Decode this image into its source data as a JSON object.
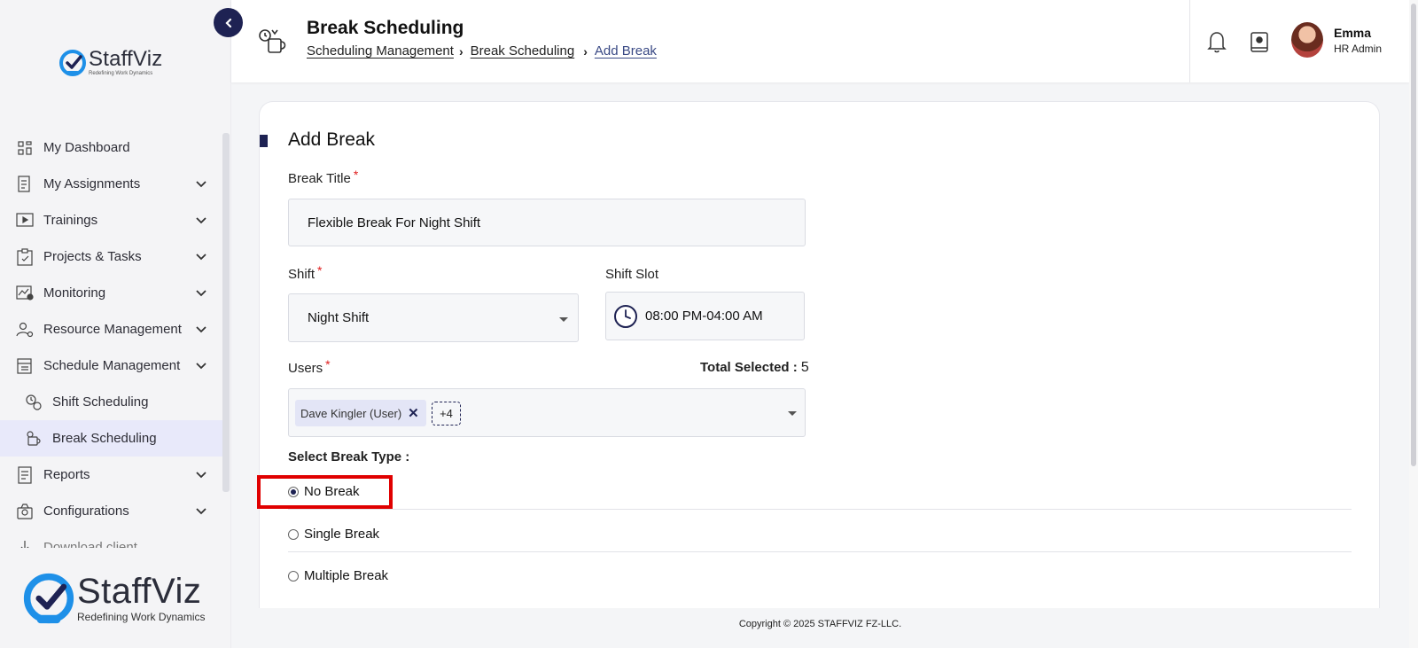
{
  "brand": {
    "name": "StaffViz",
    "tagline": "Redefining Work Dynamics"
  },
  "sidebar": {
    "items": [
      {
        "label": "My Dashboard",
        "icon": "dashboard-icon",
        "expandable": false
      },
      {
        "label": "My Assignments",
        "icon": "assignments-icon",
        "expandable": true
      },
      {
        "label": "Trainings",
        "icon": "trainings-icon",
        "expandable": true
      },
      {
        "label": "Projects & Tasks",
        "icon": "clipboard-icon",
        "expandable": true
      },
      {
        "label": "Monitoring",
        "icon": "monitoring-icon",
        "expandable": true
      },
      {
        "label": "Resource Management",
        "icon": "resource-icon",
        "expandable": true
      },
      {
        "label": "Schedule Management",
        "icon": "schedule-icon",
        "expandable": true
      },
      {
        "label": "Shift Scheduling",
        "icon": "shift-icon",
        "expandable": false,
        "sub": true
      },
      {
        "label": "Break Scheduling",
        "icon": "break-icon",
        "expandable": false,
        "sub": true,
        "active": true
      },
      {
        "label": "Reports",
        "icon": "reports-icon",
        "expandable": true
      },
      {
        "label": "Configurations",
        "icon": "configurations-icon",
        "expandable": true
      },
      {
        "label": "Download client",
        "icon": "download-icon",
        "expandable": false
      }
    ]
  },
  "header": {
    "title": "Break Scheduling",
    "breadcrumb": [
      "Scheduling Management",
      "Break Scheduling",
      "Add Break"
    ],
    "user_name": "Emma",
    "user_role": "HR Admin"
  },
  "form": {
    "title": "Add Break",
    "break_title_label": "Break Title",
    "break_title_value": "Flexible Break For Night Shift",
    "shift_label": "Shift",
    "shift_value": "Night Shift",
    "shift_slot_label": "Shift Slot",
    "shift_slot_value": "08:00 PM-04:00 AM",
    "users_label": "Users",
    "total_selected_label": "Total Selected :",
    "total_selected_value": "5",
    "user_chip": "Dave Kingler (User)",
    "more_chip": "+4",
    "break_type_label": "Select Break Type :",
    "break_types": [
      {
        "label": "No Break",
        "checked": true
      },
      {
        "label": "Single Break",
        "checked": false
      },
      {
        "label": "Multiple Break",
        "checked": false
      }
    ]
  },
  "footer": {
    "copyright": "Copyright © 2025 STAFFVIZ FZ-LLC."
  },
  "colors": {
    "primary": "#1e2253",
    "required": "#e02020",
    "highlight": "#e00000",
    "active_bg": "#e8e9fa",
    "logo_blue": "#1e90e8"
  }
}
